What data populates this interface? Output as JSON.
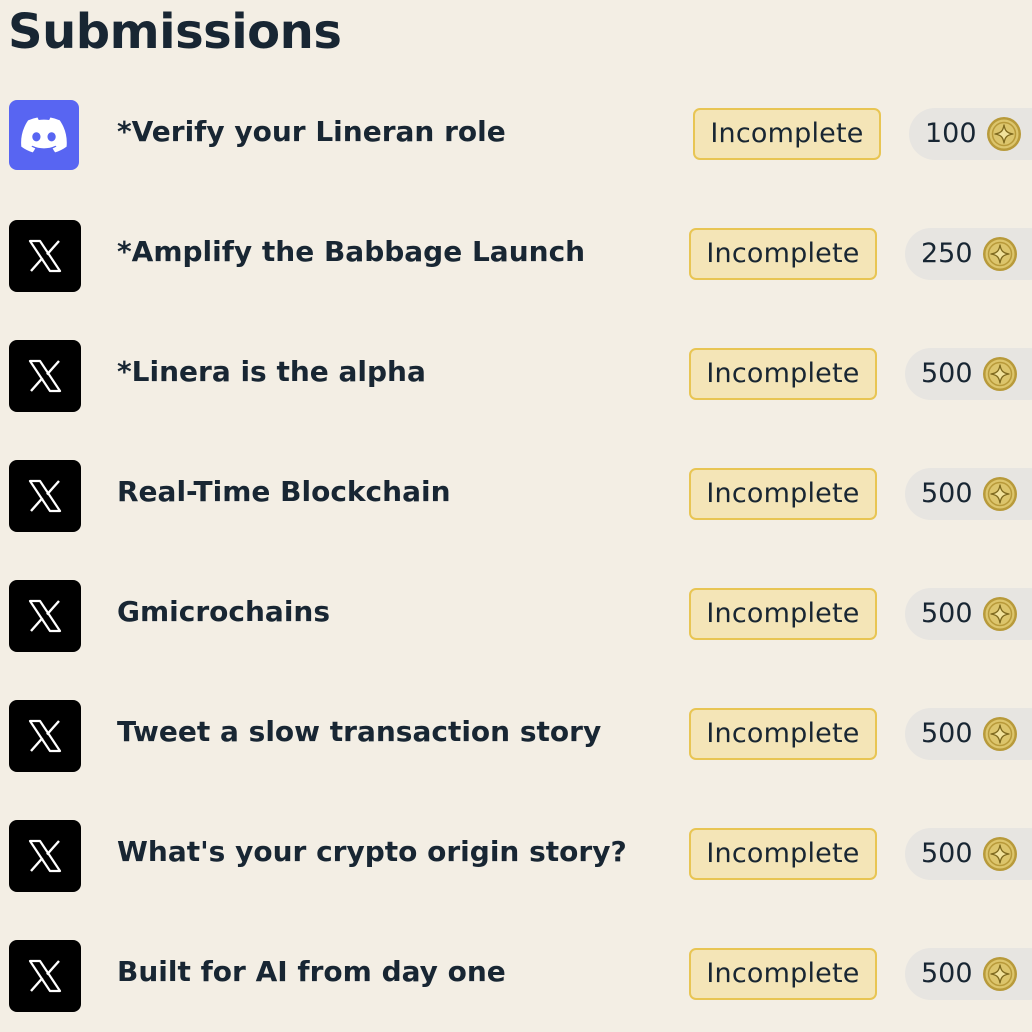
{
  "page": {
    "title": "Submissions"
  },
  "tasks": [
    {
      "platform": "discord-icon",
      "title": "*Verify your Lineran role",
      "status": "Incomplete",
      "points": "100"
    },
    {
      "platform": "x-icon",
      "title": "*Amplify the Babbage Launch",
      "status": "Incomplete",
      "points": "250"
    },
    {
      "platform": "x-icon",
      "title": "*Linera is the alpha",
      "status": "Incomplete",
      "points": "500"
    },
    {
      "platform": "x-icon",
      "title": "Real-Time Blockchain",
      "status": "Incomplete",
      "points": "500"
    },
    {
      "platform": "x-icon",
      "title": "Gmicrochains",
      "status": "Incomplete",
      "points": "500"
    },
    {
      "platform": "x-icon",
      "title": "Tweet a slow transaction story",
      "status": "Incomplete",
      "points": "500"
    },
    {
      "platform": "x-icon",
      "title": "What's your crypto origin story?",
      "status": "Incomplete",
      "points": "500"
    },
    {
      "platform": "x-icon",
      "title": "Built for AI from day one",
      "status": "Incomplete",
      "points": "500"
    }
  ],
  "colors": {
    "background": "#f3eee4",
    "text": "#182633",
    "discord": "#5865f2",
    "x": "#000000",
    "badge_fill": "#f4e5b7",
    "badge_border": "#e8c553",
    "points_pill": "#e7e5e1",
    "coin": "#d9c26a"
  }
}
